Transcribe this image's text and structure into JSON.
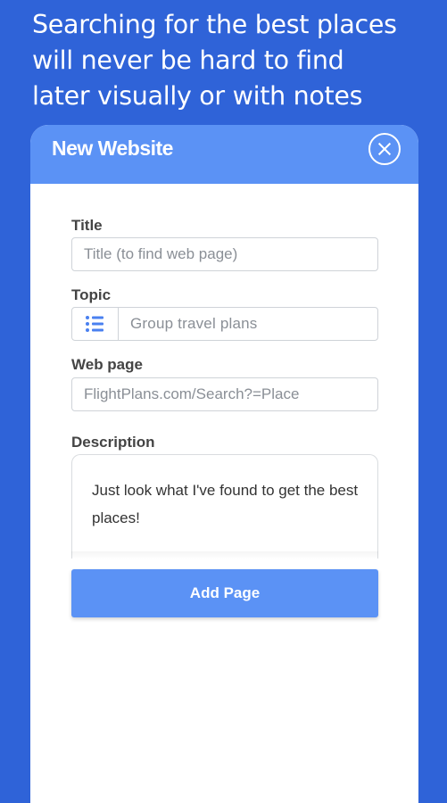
{
  "headline": {
    "line1": "Searching for the best places",
    "line2": "will never be hard to find",
    "line3": "later visually or with notes"
  },
  "dialog": {
    "title": "New Website",
    "close_icon": "close-icon",
    "fields": {
      "title": {
        "label": "Title",
        "placeholder": "Title (to find web page)",
        "value": ""
      },
      "topic": {
        "label": "Topic",
        "icon": "list-icon",
        "value": "Group travel plans"
      },
      "web_page": {
        "label": "Web page",
        "placeholder": "FlightPlans.com/Search?=Place",
        "value": ""
      },
      "description": {
        "label": "Description",
        "value": "Just look what I've found to get the best places!"
      }
    },
    "submit_label": "Add Page"
  },
  "colors": {
    "background": "#2f63d8",
    "accent": "#5b92f5",
    "icon": "#4a80f0"
  }
}
